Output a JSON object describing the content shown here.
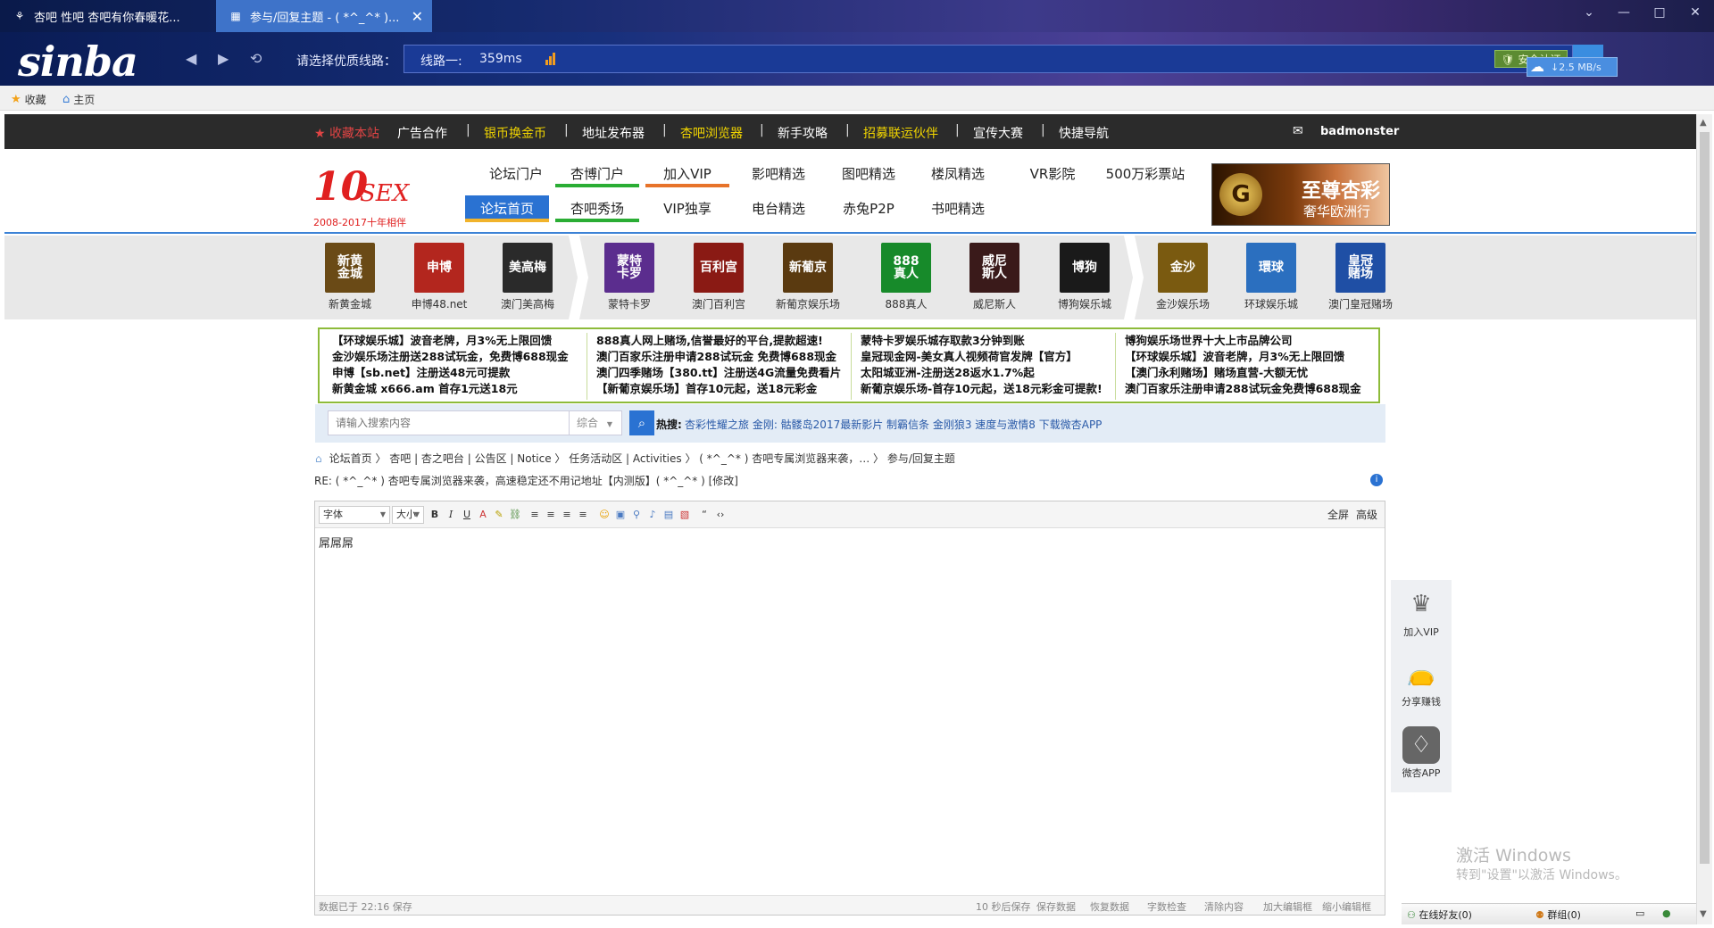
{
  "browser": {
    "tabs": [
      {
        "title": "杏吧 性吧 杏吧有你春暖花..."
      },
      {
        "title": "参与/回复主题 - ( *^_^* )..."
      }
    ],
    "logo": "sinba",
    "route_label": "请选择优质线路：",
    "route_name": "线路一:",
    "route_ms": "359ms",
    "secure_label": "安全认证",
    "speed": "2.5 MB/s",
    "favorites": [
      {
        "label": "收藏",
        "icon": "star-icon"
      },
      {
        "label": "主页",
        "icon": "home-icon"
      }
    ]
  },
  "site": {
    "top_nav": [
      "收藏本站",
      "广告合作",
      "银币换金币",
      "地址发布器",
      "杏吧浏览器",
      "新手攻略",
      "招募联运伙伴",
      "宣传大赛",
      "快捷导航"
    ],
    "username": "badmonster",
    "logo_big": "10",
    "logo_sex": "SEX",
    "logo_years": "2008-2017十年相伴",
    "header_nav_row1": [
      "论坛门户",
      "杏博门户",
      "加入VIP",
      "影吧精选",
      "图吧精选",
      "楼凤精选",
      "VR影院",
      "500万彩票站"
    ],
    "header_nav_row2": [
      "论坛首页",
      "杏吧秀场",
      "VIP独享",
      "电台精选",
      "赤兔P2P",
      "书吧精选"
    ],
    "banner_title": "至尊杏彩",
    "banner_sub": "奢华欧洲行",
    "partners": [
      {
        "name": "新黄金城",
        "logo": "新黄\n金城",
        "color": "#6a4a16"
      },
      {
        "name": "申博48.net",
        "logo": "申博",
        "color": "#b3261e"
      },
      {
        "name": "澳门美高梅",
        "logo": "美高梅",
        "color": "#2a2a2a"
      },
      {
        "name": "蒙特卡罗",
        "logo": "蒙特\n卡罗",
        "color": "#5b2d8e"
      },
      {
        "name": "澳门百利宫",
        "logo": "百利宫",
        "color": "#8a1a14"
      },
      {
        "name": "新葡京娱乐场",
        "logo": "新葡京",
        "color": "#5a3a10"
      },
      {
        "name": "888真人",
        "logo": "888\n真人",
        "color": "#178a2a"
      },
      {
        "name": "威尼斯人",
        "logo": "威尼\n斯人",
        "color": "#3a1a1a"
      },
      {
        "name": "博狗娱乐城",
        "logo": "博狗",
        "color": "#1a1a1a"
      },
      {
        "name": "金沙娱乐场",
        "logo": "金沙",
        "color": "#7a5a10"
      },
      {
        "name": "环球娱乐城",
        "logo": "環球",
        "color": "#2b6fbf"
      },
      {
        "name": "澳门皇冠赌场",
        "logo": "皇冠\n赌场",
        "color": "#1f4fa5"
      }
    ],
    "ad_columns": [
      [
        "【环球娱乐城】波音老牌，月3%无上限回馈",
        "金沙娱乐场注册送288试玩金，免费博688现金",
        "申博【sb.net】注册送48元可提款",
        "新黄金城 x666.am 首存1元送18元"
      ],
      [
        "888真人网上赌场,信誉最好的平台,提款超速!",
        "澳门百家乐注册申请288试玩金 免费博688现金",
        "澳门四季赌场【380.tt】注册送4G流量免费看片",
        "【新葡京娱乐场】首存10元起，送18元彩金"
      ],
      [
        "蒙特卡罗娱乐城存取款3分钟到账",
        "皇冠现金网-美女真人视频荷官发牌【官方】",
        "太阳城亚洲-注册送28返水1.7%起",
        "新葡京娱乐场-首存10元起，送18元彩金可提款!"
      ],
      [
        "博狗娱乐场世界十大上市品牌公司",
        "【环球娱乐城】波音老牌，月3%无上限回馈",
        "【澳门永利赌场】赌场直营-大额无忧",
        "澳门百家乐注册申请288试玩金免费博688现金"
      ]
    ],
    "search": {
      "placeholder": "请输入搜索内容",
      "type": "综合",
      "hot_label": "热搜:",
      "hot_links": "杏彩性耀之旅 金刚: 骷髅岛2017最新影片 制霸信条 金刚狼3 速度与激情8 下载微杏APP"
    },
    "breadcrumb": "论坛首页  〉 杏吧 | 杏之吧台 | 公告区 | Notice  〉 任务活动区 | Activities  〉 ( *^_^* ) 杏吧专属浏览器来袭，…  〉 参与/回复主题",
    "reply_title": "RE: ( *^_^* ) 杏吧专属浏览器来袭，高速稳定还不用记地址【内测版】( *^_^* ) [修改]",
    "editor": {
      "font_select": "字体",
      "size_select": "大小",
      "fullscreen": "全屏",
      "advanced": "高级",
      "content": "屌屌屌",
      "autosave_status": "数据已于 22:16 保存",
      "status_links": [
        "10 秒后保存",
        "保存数据",
        "恢复数据",
        "字数检查",
        "清除内容",
        "加大编辑框",
        "缩小编辑框"
      ]
    },
    "side_float": [
      {
        "label": "加入VIP",
        "icon": "crown-icon"
      },
      {
        "label": "分享赚钱",
        "icon": "money-bag-icon"
      },
      {
        "label": "微杏APP",
        "icon": "app-icon"
      }
    ]
  },
  "os": {
    "watermark_line1": "激活 Windows",
    "watermark_line2": "转到\"设置\"以激活 Windows。",
    "im_friends": "在线好友(0)",
    "im_groups": "群组(0)"
  },
  "colors": {
    "accent_blue": "#2a72d2",
    "nav_dark": "#2b2b2b",
    "green_border": "#8dbb3a"
  }
}
